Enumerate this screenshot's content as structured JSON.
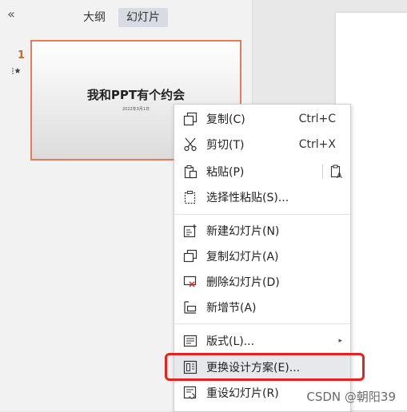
{
  "left_panel": {
    "collapse_icon": "double-chevron-left-icon",
    "tabs": [
      {
        "label": "大纲",
        "active": false
      },
      {
        "label": "幻灯片",
        "active": true
      }
    ],
    "slide": {
      "number": "1",
      "animation_icon": "star-icon",
      "title": "我和PPT有个约会",
      "date": "2022年3月1日"
    }
  },
  "context_menu": {
    "items": [
      {
        "label": "复制(C)",
        "shortcut": "Ctrl+C",
        "icon": "copy-icon"
      },
      {
        "label": "剪切(T)",
        "shortcut": "Ctrl+X",
        "icon": "scissors-icon"
      },
      {
        "label": "粘贴(P)",
        "icon": "paste-icon",
        "extra_icon": "paste-text-icon"
      },
      {
        "label": "选择性粘贴(S)...",
        "icon": "paste-special-icon"
      },
      {
        "label": "新建幻灯片(N)",
        "icon": "new-slide-icon"
      },
      {
        "label": "复制幻灯片(A)",
        "icon": "duplicate-slide-icon"
      },
      {
        "label": "删除幻灯片(D)",
        "icon": "delete-slide-icon"
      },
      {
        "label": "新增节(A)",
        "icon": "new-section-icon"
      },
      {
        "label": "版式(L)...",
        "icon": "layout-icon",
        "has_submenu": true
      },
      {
        "label": "更换设计方案(E)...",
        "icon": "design-icon",
        "highlighted": true
      },
      {
        "label": "重设幻灯片(R)",
        "icon": "reset-slide-icon"
      }
    ]
  },
  "watermark": "CSDN @朝阳39",
  "colors": {
    "slide_border": "#e57b58",
    "highlight_red": "#e4231d",
    "slide_number": "#c56a2c"
  }
}
